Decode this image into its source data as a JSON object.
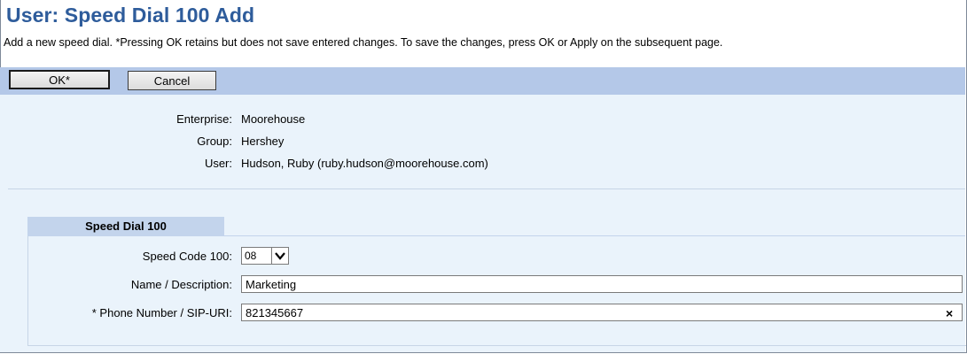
{
  "page": {
    "title": "User: Speed Dial 100 Add",
    "instructions": "Add a new speed dial. *Pressing OK retains but does not save entered changes. To save the changes, press OK or Apply on the subsequent page."
  },
  "toolbar": {
    "ok_label": "OK*",
    "cancel_label": "Cancel"
  },
  "info": {
    "enterprise_label": "Enterprise:",
    "enterprise_value": "Moorehouse",
    "group_label": "Group:",
    "group_value": "Hershey",
    "user_label": "User:",
    "user_value": "Hudson, Ruby (ruby.hudson@moorehouse.com)"
  },
  "speed_dial": {
    "section_title": "Speed Dial 100",
    "speed_code_label": "Speed Code 100:",
    "speed_code_value": "08",
    "name_label": "Name / Description:",
    "name_value": "Marketing",
    "phone_label": "* Phone Number / SIP-URI:",
    "phone_value": "821345667",
    "clear_glyph": "×"
  },
  "colors": {
    "title": "#2e5c9b",
    "toolbar_bg": "#b4c8e8",
    "content_bg": "#eaf3fb",
    "section_header_bg": "#c3d4ec"
  }
}
